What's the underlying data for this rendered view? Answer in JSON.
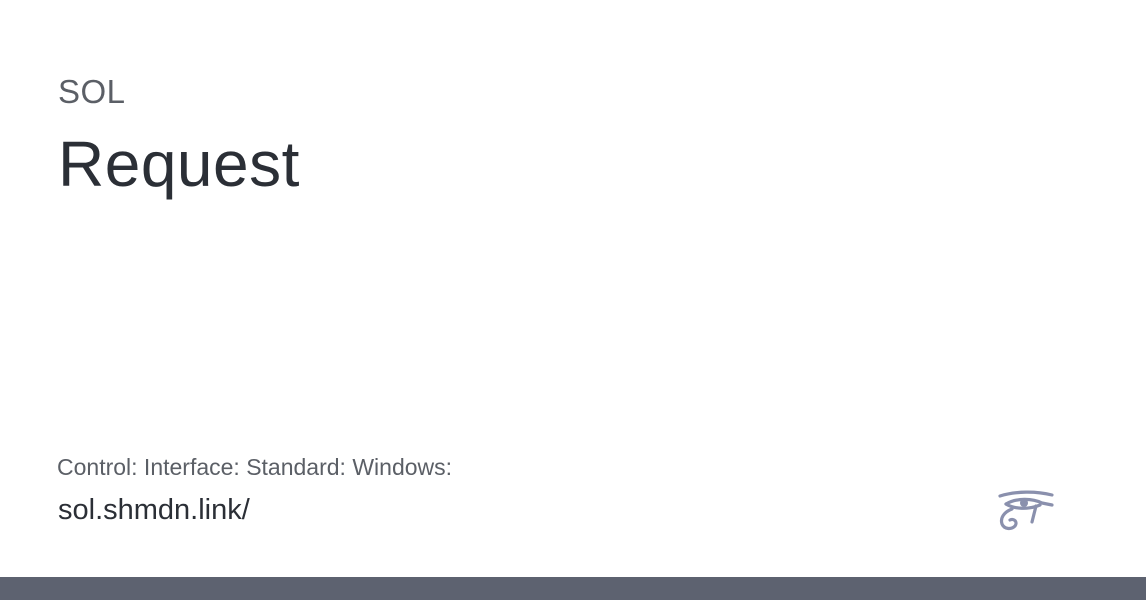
{
  "card": {
    "eyebrow": "SOL",
    "title": "Request",
    "path": "Control: Interface: Standard: Windows:",
    "url": "sol.shmdn.link/",
    "logo_icon": "eye-of-horus-icon"
  },
  "colors": {
    "background": "#ffffff",
    "text_primary": "#2b2f36",
    "text_secondary": "#5b5f66",
    "logo": "#8a90ad",
    "footer_bar": "#5d6270"
  }
}
